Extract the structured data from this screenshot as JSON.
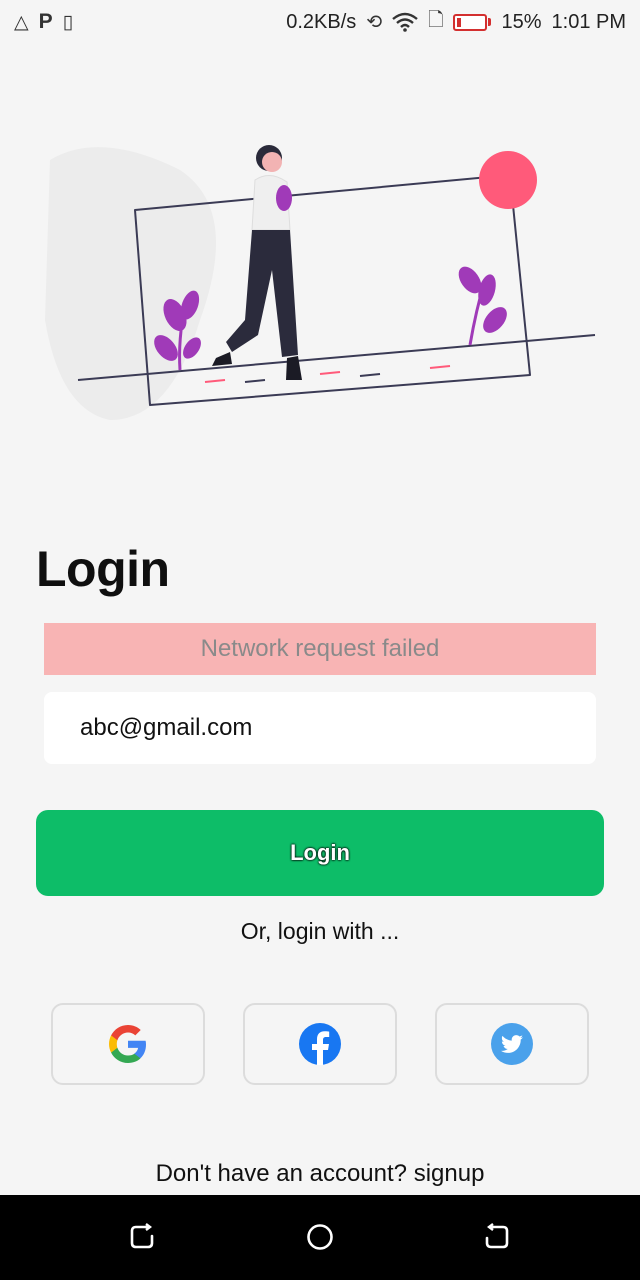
{
  "status_bar": {
    "network_speed": "0.2KB/s",
    "battery_percent": "15%",
    "time": "1:01 PM",
    "battery_level": 0.15,
    "battery_color": "#d32f2f"
  },
  "login": {
    "title": "Login",
    "error_message": "Network request failed",
    "email_value": "abc@gmail.com",
    "button_label": "Login",
    "or_text": "Or, login with ...",
    "signup_prompt": "Don't have an account?",
    "signup_link": "signup"
  },
  "social": [
    {
      "name": "google",
      "icon": "google-icon"
    },
    {
      "name": "facebook",
      "icon": "facebook-icon"
    },
    {
      "name": "twitter",
      "icon": "twitter-icon"
    }
  ],
  "colors": {
    "accent": "#0dbd68",
    "error_bg": "#f8b4b4",
    "illustration_circle": "#ff5a7a",
    "illustration_plants": "#a03ab8"
  }
}
